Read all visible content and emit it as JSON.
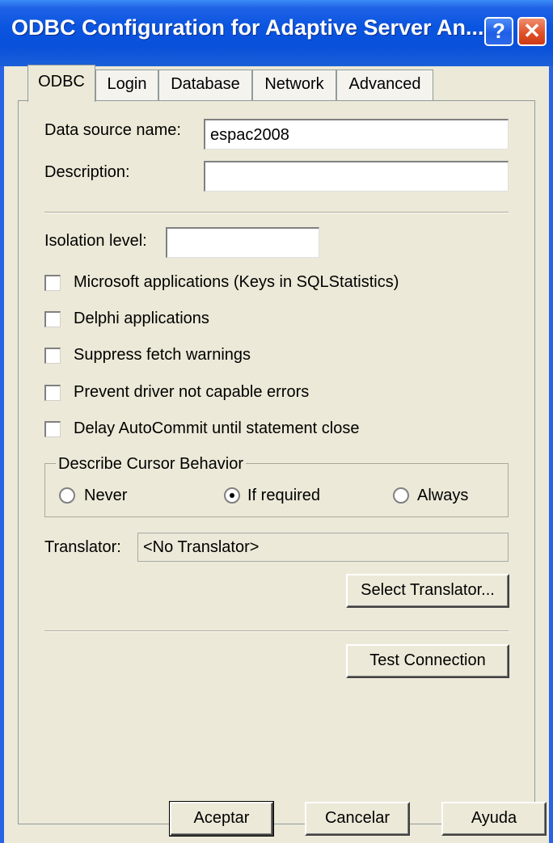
{
  "window": {
    "title": "ODBC Configuration for Adaptive Server An...",
    "help_glyph": "?",
    "close_glyph": "✕"
  },
  "tabs": [
    {
      "label": "ODBC",
      "active": true
    },
    {
      "label": "Login",
      "active": false
    },
    {
      "label": "Database",
      "active": false
    },
    {
      "label": "Network",
      "active": false
    },
    {
      "label": "Advanced",
      "active": false
    }
  ],
  "odbc": {
    "data_source_name_label": "Data source name:",
    "data_source_name_value": "espac2008",
    "description_label": "Description:",
    "description_value": "",
    "isolation_level_label": "Isolation level:",
    "isolation_level_value": "",
    "checkboxes": [
      {
        "label": "Microsoft applications (Keys in SQLStatistics)",
        "checked": false
      },
      {
        "label": "Delphi applications",
        "checked": false
      },
      {
        "label": "Suppress fetch warnings",
        "checked": false
      },
      {
        "label": "Prevent driver not capable errors",
        "checked": false
      },
      {
        "label": "Delay AutoCommit until statement close",
        "checked": false
      }
    ],
    "cursor_group_title": "Describe Cursor Behavior",
    "cursor_options": [
      {
        "label": "Never",
        "selected": false
      },
      {
        "label": "If required",
        "selected": true
      },
      {
        "label": "Always",
        "selected": false
      }
    ],
    "translator_label": "Translator:",
    "translator_value": "<No Translator>",
    "select_translator_label": "Select Translator...",
    "test_connection_label": "Test Connection"
  },
  "footer": {
    "ok_label": "Aceptar",
    "cancel_label": "Cancelar",
    "help_label": "Ayuda"
  }
}
